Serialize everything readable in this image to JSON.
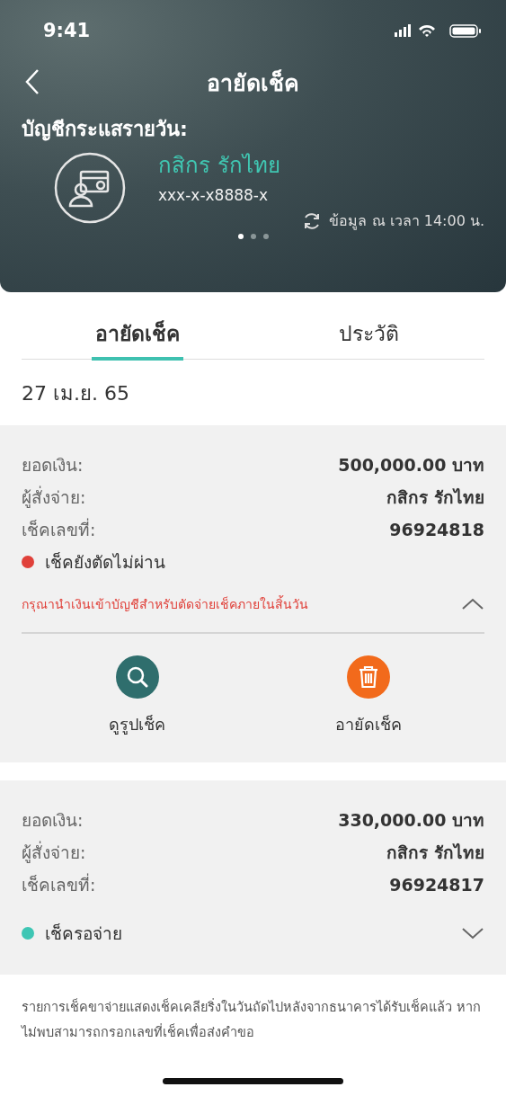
{
  "status_bar": {
    "time": "9:41"
  },
  "header": {
    "title": "อายัดเช็ค",
    "account_label": "บัญชีกระแสรายวัน:",
    "account_name": "กสิกร รักไทย",
    "account_number": "xxx-x-x8888-x",
    "updated": "ข้อมูล ณ เวลา 14:00 น.",
    "pages": [
      {
        "selected": true
      },
      {
        "selected": false
      },
      {
        "selected": false
      }
    ]
  },
  "tabs": [
    {
      "label": "อายัดเช็ค",
      "selected": true
    },
    {
      "label": "ประวัติ",
      "selected": false
    }
  ],
  "date": "27 เม.ย. 65",
  "cheques": [
    {
      "fields": [
        {
          "label": "ยอดเงิน:",
          "value": "500,000.00 บาท"
        },
        {
          "label": "ผู้สั่งจ่าย:",
          "value": "กสิกร รักไทย"
        },
        {
          "label": "เช็คเลขที่:",
          "value": "96924818"
        }
      ],
      "status": "เช็คยังตัดไม่ผ่าน",
      "color": "#e0413a",
      "expanded": true,
      "warning": "กรุณานำเงินเข้าบัญชีสำหรับตัดจ่ายเช็คภายในสิ้นวัน",
      "actions": [
        {
          "kind": "view",
          "label": "ดูรูปเช็ค"
        },
        {
          "kind": "freeze",
          "label": "อายัดเช็ค"
        }
      ]
    },
    {
      "fields": [
        {
          "label": "ยอดเงิน:",
          "value": "330,000.00 บาท"
        },
        {
          "label": "ผู้สั่งจ่าย:",
          "value": "กสิกร รักไทย"
        },
        {
          "label": "เช็คเลขที่:",
          "value": "96924817"
        }
      ],
      "status": "เช็ครอจ่าย",
      "color": "#3ec6b4",
      "expanded": false
    }
  ],
  "note": "รายการเช็คขาจ่ายแสดงเช็คเคลียริ่งในวันถัดไปหลังจากธนาคารได้รับเช็คแล้ว หากไม่พบสามารถกรอกเลขที่เช็คเพื่อส่งคำขอ"
}
